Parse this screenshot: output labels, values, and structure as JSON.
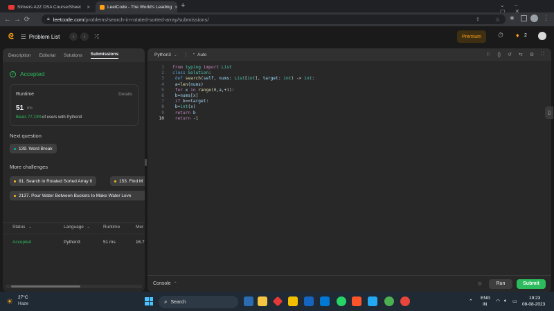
{
  "browser": {
    "tabs": [
      {
        "title": "Strivers A2Z DSA Course/Sheet",
        "favicon_color": "#e53935"
      },
      {
        "title": "LeetCode - The World's Leading",
        "favicon_color": "#ffa116"
      }
    ],
    "new_tab": "+",
    "url_host": "leetcode.com",
    "url_path": "/problems/search-in-rotated-sorted-array/submissions/"
  },
  "nav": {
    "problem_list": "Problem List",
    "premium": "Premium",
    "streak_count": "2"
  },
  "left_panel": {
    "tabs": [
      "Description",
      "Editorial",
      "Solutions",
      "Submissions"
    ],
    "status": "Accepted",
    "runtime_label": "Runtime",
    "details_label": "Details",
    "runtime_value": "51",
    "runtime_unit": "ms",
    "beats_pct": "Beats 77.23%",
    "beats_suffix": "of users with Python3",
    "next_question_heading": "Next question",
    "next_question": "139. Word Break",
    "more_challenges_heading": "More challenges",
    "challenges": [
      "81. Search in Rotated Sorted Array II",
      "153. Find M",
      "2137. Pour Water Between Buckets to Make Water Leve"
    ],
    "table": {
      "headers": [
        "Status",
        "Language",
        "Runtime",
        "Mer"
      ],
      "row": [
        "Accepted",
        "Python3",
        "51 ms",
        "16.7"
      ]
    }
  },
  "editor": {
    "language": "Python3",
    "mode": "Auto",
    "console_label": "Console",
    "run_label": "Run",
    "submit_label": "Submit",
    "code_lines": [
      "from typing import List",
      "class Solution:",
      "    def search(self, nums: List[int], target: int) -> int:",
      "        a=len(nums)",
      "        for x in range(0,a,+1):",
      "            b=nums[x]",
      "            if b==target:",
      "                b=int(x)",
      "                return b",
      "        return -1"
    ]
  },
  "taskbar": {
    "weather_temp": "27°C",
    "weather_desc": "Haze",
    "search_label": "Search",
    "lang": "ENG",
    "region": "IN",
    "time": "19:23",
    "date": "08-08-2023"
  },
  "colors": {
    "accent_green": "#2cbb5d",
    "leetcode_orange": "#ffa116",
    "submit_green": "#2cbb5d"
  }
}
